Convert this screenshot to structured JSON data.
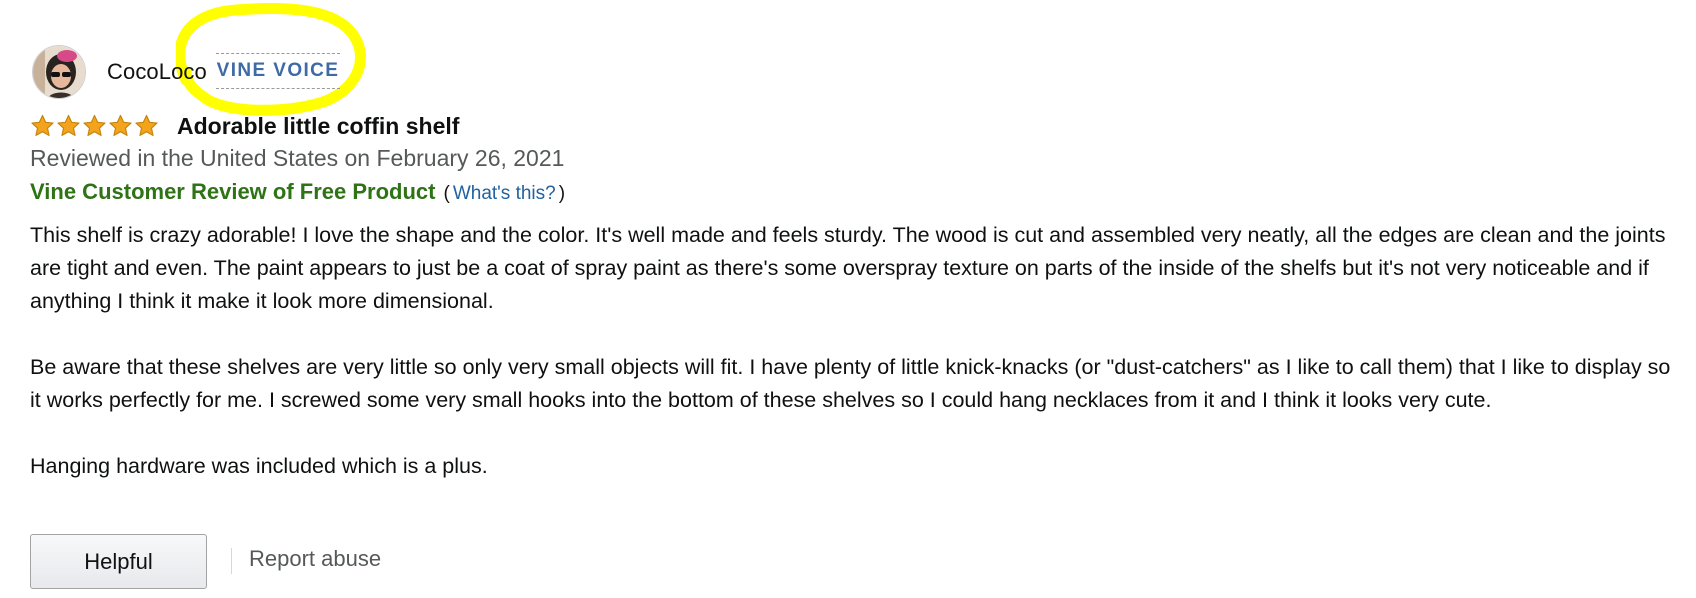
{
  "reviewer": {
    "name": "CocoLoco",
    "badge": "VINE VOICE",
    "avatar_icon": "reviewer-avatar"
  },
  "review": {
    "rating": 5,
    "max_rating": 5,
    "star_color": "#f4a41c",
    "title": "Adorable little coffin shelf",
    "date_line": "Reviewed in the United States on February 26, 2021",
    "vine_label": "Vine Customer Review of Free Product",
    "vine_open_paren": "(",
    "whats_this_link": "What's this?",
    "vine_close_paren": ")",
    "paragraphs": [
      "This shelf is crazy adorable! I love the shape and the color. It's well made and feels sturdy. The wood is cut and assembled very neatly, all the edges are clean and the joints are tight and even. The paint appears to just be a coat of spray paint as there's some overspray texture on parts of the inside of the shelfs but it's not very noticeable and if anything I think it make it look more dimensional.",
      "Be aware that these shelves are very little so only very small objects will fit. I have plenty of little knick-knacks (or \"dust-catchers\" as I like to call them) that I like to display so it works perfectly for me. I screwed some very small hooks into the bottom of these shelves so I could hang necklaces from it and I think it looks very cute.",
      "Hanging hardware was included which is a plus."
    ]
  },
  "actions": {
    "helpful_label": "Helpful",
    "report_label": "Report abuse"
  },
  "colors": {
    "vine_badge": "#3e6aa6",
    "vine_label": "#2e7315",
    "link": "#2162a1",
    "highlight": "#ffff00"
  }
}
